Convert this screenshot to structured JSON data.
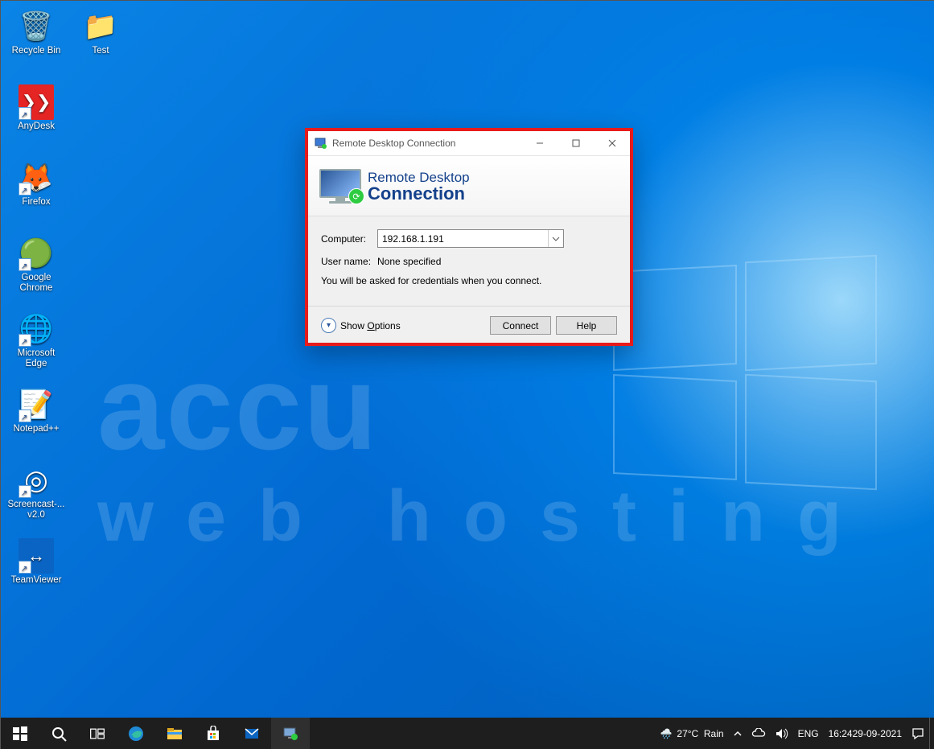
{
  "desktop_icons_col1": [
    {
      "id": "recycle-bin",
      "label": "Recycle Bin",
      "glyph": "🗑️",
      "shortcut": false,
      "bg": ""
    },
    {
      "id": "anydesk",
      "label": "AnyDesk",
      "glyph": "❯❯",
      "shortcut": true,
      "bg": "#e52424"
    },
    {
      "id": "firefox",
      "label": "Firefox",
      "glyph": "🦊",
      "shortcut": true,
      "bg": ""
    },
    {
      "id": "chrome",
      "label": "Google Chrome",
      "glyph": "🟢",
      "shortcut": true,
      "bg": ""
    },
    {
      "id": "edge",
      "label": "Microsoft Edge",
      "glyph": "🌐",
      "shortcut": true,
      "bg": ""
    },
    {
      "id": "notepadpp",
      "label": "Notepad++",
      "glyph": "📝",
      "shortcut": true,
      "bg": ""
    },
    {
      "id": "screencast",
      "label": "Screencast-... v2.0",
      "glyph": "◎",
      "shortcut": true,
      "bg": ""
    },
    {
      "id": "teamviewer",
      "label": "TeamViewer",
      "glyph": "↔",
      "shortcut": true,
      "bg": "#0a64c4"
    }
  ],
  "desktop_icons_col2": [
    {
      "id": "test-folder",
      "label": "Test",
      "glyph": "📁",
      "shortcut": false,
      "bg": ""
    }
  ],
  "dialog": {
    "title": "Remote Desktop Connection",
    "banner_line1": "Remote Desktop",
    "banner_line2": "Connection",
    "computer_label": "Computer:",
    "computer_value": "192.168.1.191",
    "username_label": "User name:",
    "username_value": "None specified",
    "hint": "You will be asked for credentials when you connect.",
    "show_options_pre": "Show ",
    "show_options_u": "O",
    "show_options_post": "ptions",
    "connect": "Connect",
    "help": "Help"
  },
  "taskbar": {
    "weather_temp": "27°C",
    "weather_cond": "Rain",
    "lang": "ENG",
    "time": "16:24",
    "date": "29-09-2021"
  },
  "watermark": {
    "row1": "accu",
    "row2": "web hosting"
  }
}
